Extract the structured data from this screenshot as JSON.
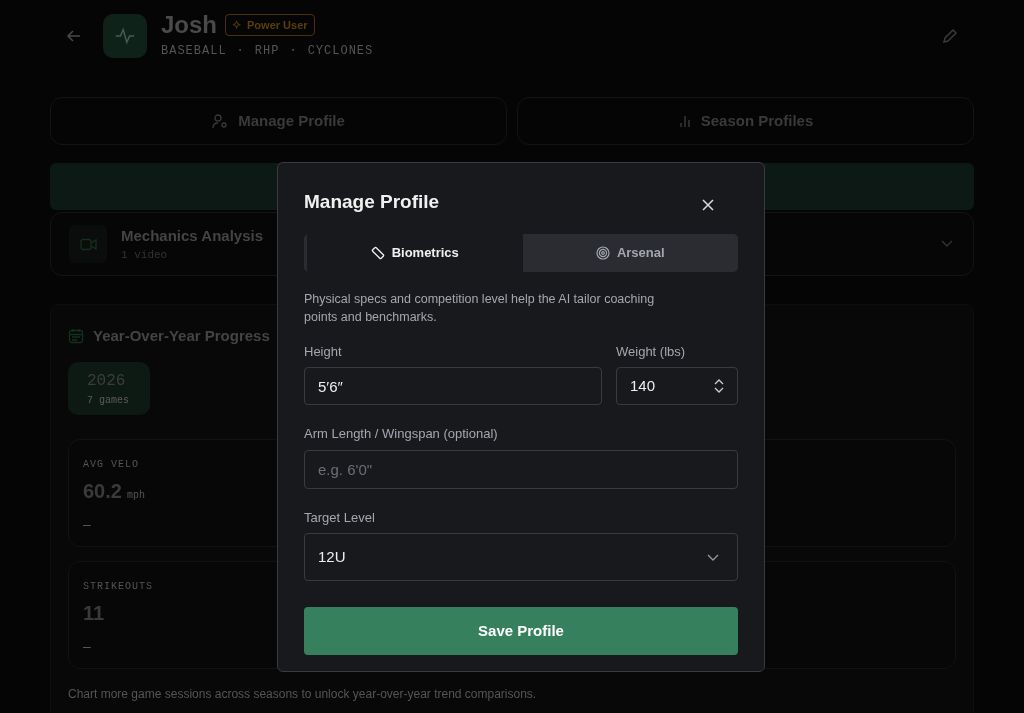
{
  "header": {
    "name": "Josh",
    "badge": "Power User",
    "subtitle": [
      "BASEBALL",
      "·",
      "RHP",
      "·",
      "CYCLONES"
    ]
  },
  "nav_buttons": [
    {
      "kind": "profile",
      "label": "Manage Profile"
    },
    {
      "kind": "seasons",
      "label": "Season Profiles"
    }
  ],
  "mechanics": {
    "title": "Mechanics Analysis",
    "count": "1 video"
  },
  "progress": {
    "title": "Year-Over-Year Progress",
    "seasons": [
      {
        "year": "2026",
        "games": "7 games",
        "selected": true
      }
    ],
    "stats": [
      {
        "label": "AVG VELO",
        "value": "60.2",
        "unit": "mph",
        "trend": "–"
      },
      {
        "label": "STRIKEOUTS",
        "value": "11",
        "trend": "–"
      }
    ],
    "note": "Chart more game sessions across seasons to unlock year-over-year trend comparisons."
  },
  "modal": {
    "title": "Manage Profile",
    "tabs": [
      {
        "kind": "ruler",
        "label": "Biometrics",
        "selected": true
      },
      {
        "kind": "target",
        "label": "Arsenal",
        "selected": false
      }
    ],
    "description": "Physical specs and competition level help the AI tailor coaching points and benchmarks.",
    "height": {
      "label": "Height",
      "value": "5′6″"
    },
    "weight": {
      "label": "Weight (lbs)",
      "value": "140"
    },
    "arm_length": {
      "label": "Arm Length / Wingspan (optional)",
      "placeholder": "e.g. 6'0\""
    },
    "target_level": {
      "label": "Target Level",
      "value": "12U"
    },
    "save_button": "Save Profile"
  }
}
